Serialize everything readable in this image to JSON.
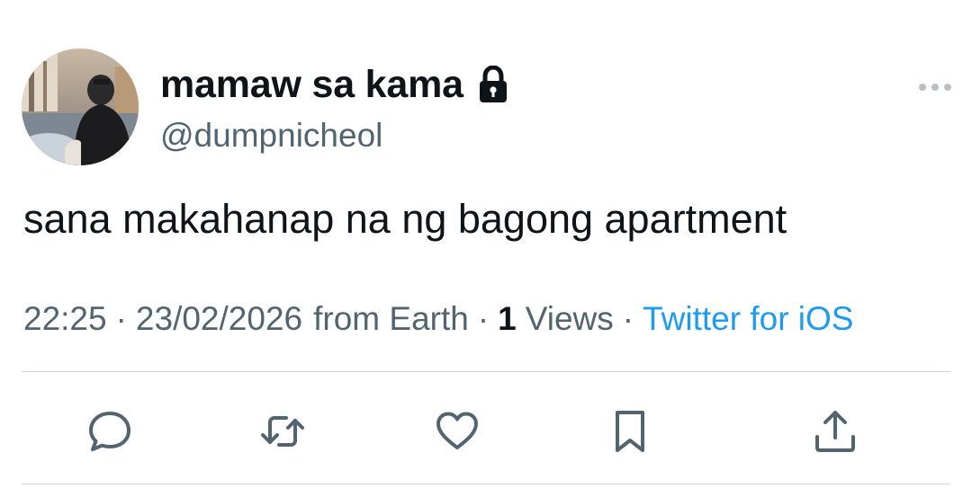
{
  "tweet": {
    "author": {
      "display_name": "mamaw sa kama",
      "handle": "@dumpnicheol",
      "protected_icon": "lock-icon",
      "avatar_icon": "profile-photo"
    },
    "text": "sana makahanap na ng bagong apartment",
    "meta": {
      "time": "22:25",
      "date": "23/02/2026",
      "location": "from Earth",
      "separator": "·",
      "views_count": "1",
      "views_label": "Views",
      "source": "Twitter for iOS"
    },
    "more_icon": "more-horizontal-icon",
    "actions": [
      {
        "name": "reply",
        "icon": "reply-icon"
      },
      {
        "name": "retweet",
        "icon": "retweet-icon"
      },
      {
        "name": "like",
        "icon": "heart-icon"
      },
      {
        "name": "bookmark",
        "icon": "bookmark-icon"
      },
      {
        "name": "share",
        "icon": "share-icon"
      }
    ]
  },
  "colors": {
    "text_primary": "#0f1419",
    "text_secondary": "#536471",
    "link": "#1d9bf0",
    "divider": "#cfd9de"
  }
}
